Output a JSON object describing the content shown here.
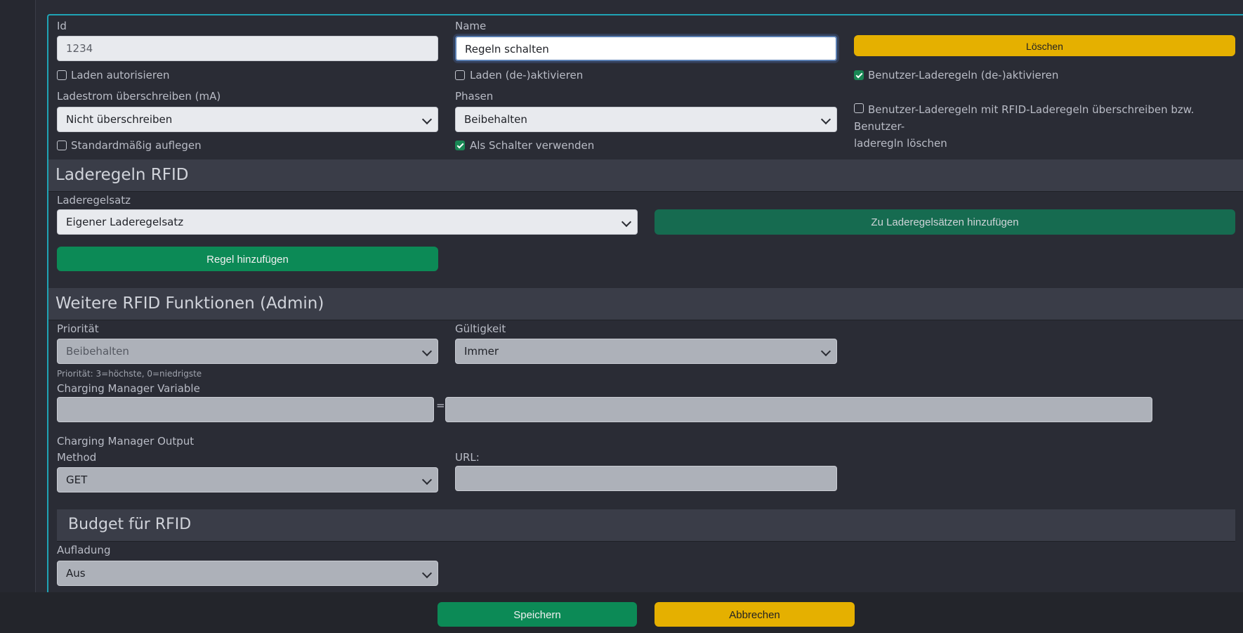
{
  "form": {
    "id_label": "Id",
    "id_value": "1234",
    "name_label": "Name",
    "name_value": "Regeln schalten",
    "delete_button": "Löschen",
    "authorize_label": "Laden autorisieren",
    "activate_label": "Laden (de-)aktivieren",
    "user_rules_label": "Benutzer-Laderegeln (de-)aktivieren",
    "current_label": "Ladestrom überschreiben (mA)",
    "current_value": "Nicht überschreiben",
    "phases_label": "Phasen",
    "phases_value": "Beibehalten",
    "override_label_line1": "Benutzer-Laderegeln mit RFID-Laderegeln überschreiben bzw. Benutzer-",
    "override_label_line2": "laderegln löschen",
    "default_hangup_label": "Standardmäßig auflegen",
    "switch_label": "Als Schalter verwenden"
  },
  "rules": {
    "title": "Laderegeln RFID",
    "set_label": "Laderegelsatz",
    "set_value": "Eigener Laderegelsatz",
    "add_to_sets_button": "Zu Laderegelsätzen hinzufügen",
    "add_rule_button": "Regel hinzufügen"
  },
  "admin": {
    "title": "Weitere RFID Funktionen (Admin)",
    "priority_label": "Priorität",
    "priority_value": "Beibehalten",
    "priority_hint": "Priorität: 3=höchste, 0=niedrigste",
    "validity_label": "Gültigkeit",
    "validity_value": "Immer",
    "cm_variable_label": "Charging Manager Variable",
    "cm_variable_name": "",
    "equals": "=",
    "cm_variable_value": "",
    "cm_output_label": "Charging Manager Output",
    "method_label": "Method",
    "method_value": "GET",
    "url_label": "URL:",
    "url_value": ""
  },
  "budget": {
    "title": "Budget für RFID",
    "charging_label": "Aufladung",
    "charging_value": "Aus"
  },
  "footer": {
    "save_button": "Speichern",
    "cancel_button": "Abbrechen"
  },
  "checkboxes": {
    "authorize": false,
    "activate": false,
    "user_rules": true,
    "override": false,
    "default_hangup": false,
    "switch": true
  },
  "colors": {
    "accent_border": "#1fa4b5",
    "green": "#0c8a56",
    "yellow": "#e5b000",
    "background": "#2a2c35"
  }
}
